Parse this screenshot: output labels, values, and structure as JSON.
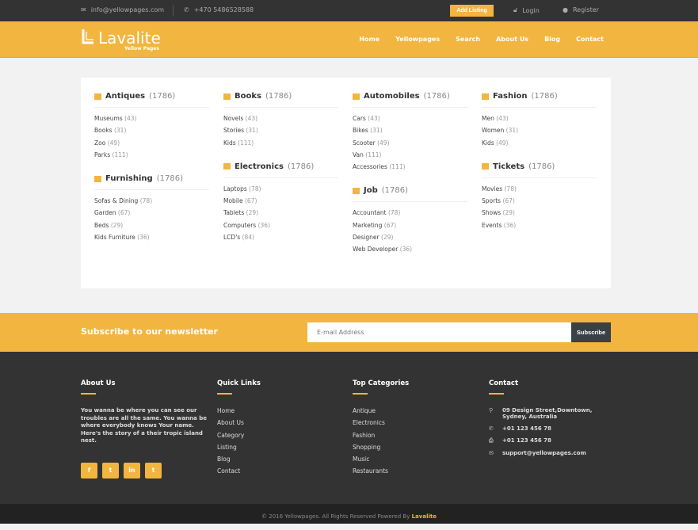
{
  "topbar": {
    "email": "info@yellowpages.com",
    "phone": "+470 5486528588",
    "add_listing": "Add Listing",
    "login": "Login",
    "register": "Register"
  },
  "header": {
    "logo": "Lavalite",
    "logo_sub": "Yellow Pages",
    "nav": [
      "Home",
      "Yellowpages",
      "Search",
      "About Us",
      "Blog",
      "Contact"
    ]
  },
  "columns": [
    [
      {
        "title": "Antiques",
        "count": "(1786)",
        "items": [
          [
            "Museums",
            "(43)"
          ],
          [
            "Books",
            "(31)"
          ],
          [
            "Zoo",
            "(49)"
          ],
          [
            "Parks",
            "(111)"
          ]
        ]
      },
      {
        "title": "Furnishing",
        "count": "(1786)",
        "items": [
          [
            "Sofas & Dining",
            "(78)"
          ],
          [
            "Garden",
            "(67)"
          ],
          [
            "Beds",
            "(29)"
          ],
          [
            "Kids Furniture",
            "(36)"
          ]
        ]
      }
    ],
    [
      {
        "title": "Books",
        "count": "(1786)",
        "items": [
          [
            "Novels",
            "(43)"
          ],
          [
            "Stories",
            "(31)"
          ],
          [
            "Kids",
            "(111)"
          ]
        ]
      },
      {
        "title": "Electronics",
        "count": "(1786)",
        "items": [
          [
            "Laptops",
            "(78)"
          ],
          [
            "Mobile",
            "(67)"
          ],
          [
            "Tablets",
            "(29)"
          ],
          [
            "Computers",
            "(36)"
          ],
          [
            "LCD's",
            "(84)"
          ]
        ]
      }
    ],
    [
      {
        "title": "Automobiles",
        "count": "(1786)",
        "items": [
          [
            "Cars",
            "(43)"
          ],
          [
            "Bikes",
            "(31)"
          ],
          [
            "Scooter",
            "(49)"
          ],
          [
            "Van",
            "(111)"
          ],
          [
            "Accessories",
            "(111)"
          ]
        ]
      },
      {
        "title": "Job",
        "count": "(1786)",
        "items": [
          [
            "Accountant",
            "(78)"
          ],
          [
            "Marketing",
            "(67)"
          ],
          [
            "Designer",
            "(29)"
          ],
          [
            "Web Developer",
            "(36)"
          ]
        ]
      }
    ],
    [
      {
        "title": "Fashion",
        "count": "(1786)",
        "items": [
          [
            "Men",
            "(43)"
          ],
          [
            "Women",
            "(31)"
          ],
          [
            "Kids",
            "(49)"
          ]
        ]
      },
      {
        "title": "Tickets",
        "count": "(1786)",
        "items": [
          [
            "Movies",
            "(78)"
          ],
          [
            "Sports",
            "(67)"
          ],
          [
            "Shows",
            "(29)"
          ],
          [
            "Events",
            "(36)"
          ]
        ]
      }
    ]
  ],
  "newsletter": {
    "title": "Subscribe to our newsletter",
    "placeholder": "E-mail Address",
    "button": "Subscribe"
  },
  "footer": {
    "about": {
      "title": "About Us",
      "text": "You wanna be where you can see our troubles are all the same. You wanna be where everybody knows Your name. Here's the story of a their tropic island nest.",
      "social": [
        "f",
        "t",
        "in",
        "t"
      ]
    },
    "quick": {
      "title": "Quick Links",
      "items": [
        "Home",
        "About Us",
        "Category",
        "Listing",
        "Blog",
        "Contact"
      ]
    },
    "top": {
      "title": "Top Categories",
      "items": [
        "Antique",
        "Electronics",
        "Fashion",
        "Shopping",
        "Music",
        "Restaurants"
      ]
    },
    "contact": {
      "title": "Contact",
      "address": "09 Design Street,Downtown, Sydney, Australia",
      "phone": "+01 123 456 78",
      "fax": "+01 123 456 78",
      "email": "support@yellowpages.com"
    }
  },
  "copyright": "© 2016 Yellowpages. All Rights Reserved Powered By",
  "copyright_brand": "Lavalite"
}
